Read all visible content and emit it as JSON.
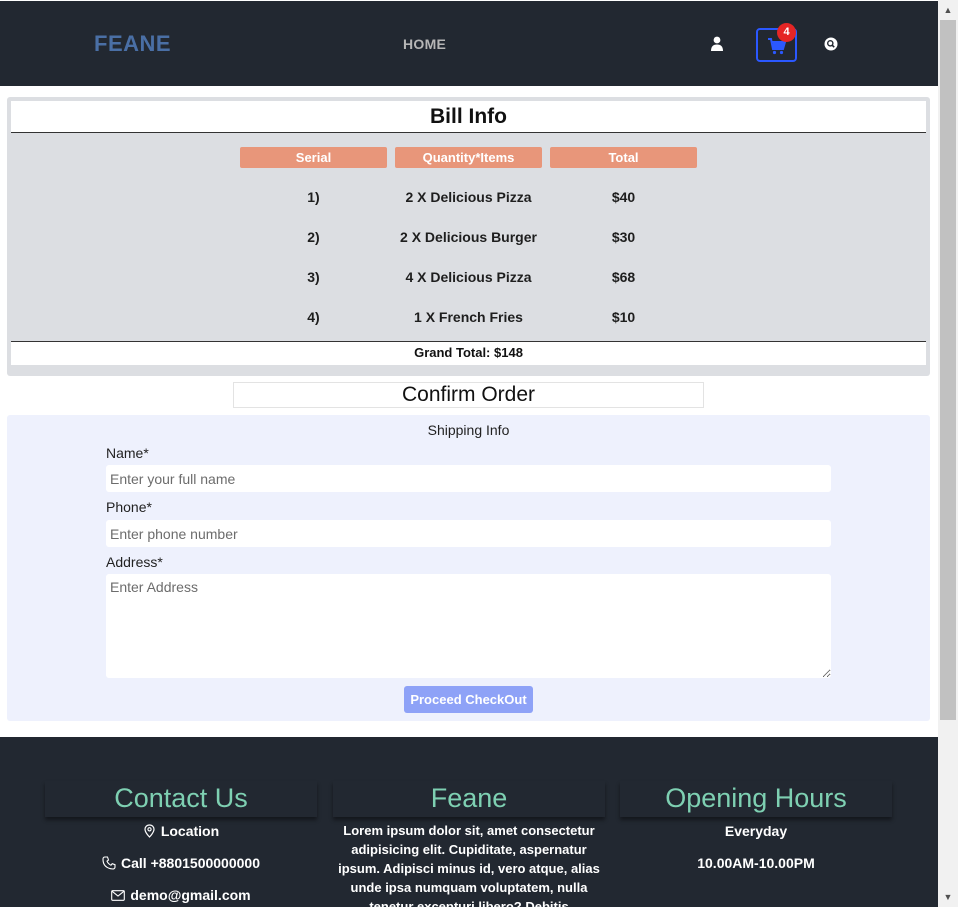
{
  "header": {
    "brand": "FEANE",
    "nav_home": "HOME",
    "cart_count": "4",
    "colors": {
      "background": "#222831",
      "brand": "#4a6fa5",
      "cart_border": "#2b58ff",
      "badge": "#e52525"
    },
    "icons": {
      "user": "user-icon",
      "cart": "cart-icon",
      "search": "search-icon"
    }
  },
  "bill": {
    "title": "Bill Info",
    "columns": [
      "Serial",
      "Quantity*Items",
      "Total"
    ],
    "rows": [
      {
        "serial": "1)",
        "item": "2 X Delicious Pizza",
        "total": "$40"
      },
      {
        "serial": "2)",
        "item": "2 X Delicious Burger",
        "total": "$30"
      },
      {
        "serial": "3)",
        "item": "4 X Delicious Pizza",
        "total": "$68"
      },
      {
        "serial": "4)",
        "item": "1 X French Fries",
        "total": "$10"
      }
    ],
    "grand_total": "Grand Total: $148",
    "header_color": "#e8967a"
  },
  "order": {
    "title": "Confirm Order",
    "shipping_title": "Shipping Info",
    "name_label": "Name*",
    "name_placeholder": "Enter your full name",
    "phone_label": "Phone*",
    "phone_placeholder": "Enter phone number",
    "address_label": "Address*",
    "address_placeholder": "Enter Address",
    "checkout_label": "Proceed CheckOut",
    "button_color": "#8ea2f7"
  },
  "footer": {
    "contact": {
      "title": "Contact Us",
      "location": "Location",
      "phone": "Call +8801500000000",
      "email": "demo@gmail.com"
    },
    "about": {
      "title": "Feane",
      "text": "Lorem ipsum dolor sit, amet consectetur adipisicing elit. Cupiditate, aspernatur ipsum. Adipisci minus id, vero atque, alias unde ipsa numquam voluptatem, nulla tenetur excepturi libero? Debitis"
    },
    "hours": {
      "title": "Opening Hours",
      "days": "Everyday",
      "time": "10.00AM-10.00PM"
    },
    "heading_color": "#7ed0b2"
  },
  "scrollbar": {
    "up": "▲",
    "down": "▼"
  }
}
